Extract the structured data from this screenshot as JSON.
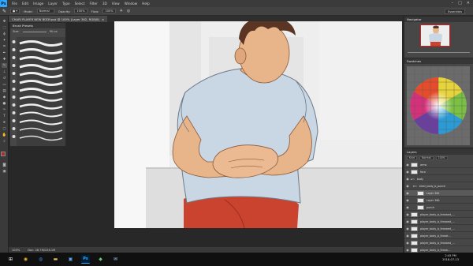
{
  "app": {
    "logo_text": "Ps"
  },
  "menubar": {
    "items": [
      "File",
      "Edit",
      "Image",
      "Layer",
      "Type",
      "Select",
      "Filter",
      "3D",
      "View",
      "Window",
      "Help"
    ],
    "controls": [
      "–",
      "□",
      "✕"
    ]
  },
  "options": {
    "mode_label": "Mode:",
    "mode_value": "Normal",
    "opacity_label": "Opacity:",
    "opacity_value": "100%",
    "flow_label": "Flow:",
    "flow_value": "100%",
    "workspace": "Essentials"
  },
  "document": {
    "tab_title": "CHARI PLAYER NEW BODY.psd @ 100% (Layer 362, RGB/8)",
    "tab_close": "×"
  },
  "brush_panel": {
    "title": "Brush Presets",
    "size_label": "Size:",
    "size_value": "90 px"
  },
  "statusbar": {
    "zoom": "100%",
    "doc_info": "Doc: 28.7M/226.1M"
  },
  "panels": {
    "navigator": "Navigator",
    "swatches": "Swatches",
    "layers": "Layers",
    "layers_kind": "Kind",
    "blend_mode": "Normal",
    "opacity": "100%"
  },
  "layers": [
    {
      "name": "arms",
      "visible": true,
      "selected": false
    },
    {
      "name": "face",
      "visible": true,
      "selected": false
    },
    {
      "name": "body",
      "visible": true,
      "selected": false
    },
    {
      "name": "steel_body_b_punch",
      "visible": true,
      "selected": false
    },
    {
      "name": "Layer 362",
      "visible": true,
      "selected": true
    },
    {
      "name": "Layer 360",
      "visible": true,
      "selected": false
    },
    {
      "name": "punch",
      "visible": true,
      "selected": false
    },
    {
      "name": "player_body_b_throwed_...",
      "visible": true,
      "selected": false
    },
    {
      "name": "player_body_b_throwed_...",
      "visible": true,
      "selected": false
    },
    {
      "name": "player_body_b_throwed_...",
      "visible": true,
      "selected": false
    },
    {
      "name": "player_body_b_threat...",
      "visible": true,
      "selected": false
    },
    {
      "name": "player_body_b_throwed_...",
      "visible": true,
      "selected": false
    },
    {
      "name": "player_body_b_throw...",
      "visible": true,
      "selected": false
    }
  ],
  "taskbar": {
    "icons": [
      {
        "name": "start-icon",
        "glyph": "⊞",
        "color": "#ffffff"
      },
      {
        "name": "chrome-icon",
        "glyph": "◉",
        "color": "#e0b030"
      },
      {
        "name": "browser-icon",
        "glyph": "◍",
        "color": "#3a7bd5"
      },
      {
        "name": "folder-icon",
        "glyph": "▬",
        "color": "#e8c15a"
      },
      {
        "name": "store-icon",
        "glyph": "▣",
        "color": "#5aa0e6"
      },
      {
        "name": "photoshop-icon",
        "glyph": "Ps",
        "color": "#31a8ff"
      },
      {
        "name": "app-icon",
        "glyph": "◆",
        "color": "#6fbf73"
      },
      {
        "name": "mail-icon",
        "glyph": "✉",
        "color": "#9cc3f0"
      }
    ],
    "time": "2:45 PM",
    "date": "2018-07-13"
  },
  "colors": {
    "accent": "#31a8ff",
    "shirt": "#c9d6e3",
    "shorts": "#c9432f",
    "skin": "#e8b48a",
    "hair": "#5a3524"
  }
}
